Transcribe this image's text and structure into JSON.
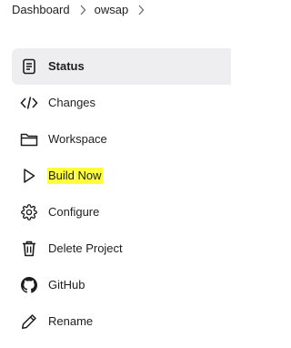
{
  "breadcrumb": {
    "items": [
      "Dashboard",
      "owsap"
    ]
  },
  "sidebar": {
    "items": [
      {
        "label": "Status",
        "icon": "document-icon",
        "active": true
      },
      {
        "label": "Changes",
        "icon": "code-icon"
      },
      {
        "label": "Workspace",
        "icon": "folder-icon"
      },
      {
        "label": "Build Now",
        "icon": "play-icon",
        "highlight_color": "#ffff3b"
      },
      {
        "label": "Configure",
        "icon": "gear-icon"
      },
      {
        "label": "Delete Project",
        "icon": "trash-icon"
      },
      {
        "label": "GitHub",
        "icon": "github-icon"
      },
      {
        "label": "Rename",
        "icon": "pencil-icon"
      }
    ]
  },
  "colors": {
    "active_bg": "#eeeef0",
    "text": "#1e1e1e",
    "highlight": "#ffff3b"
  }
}
